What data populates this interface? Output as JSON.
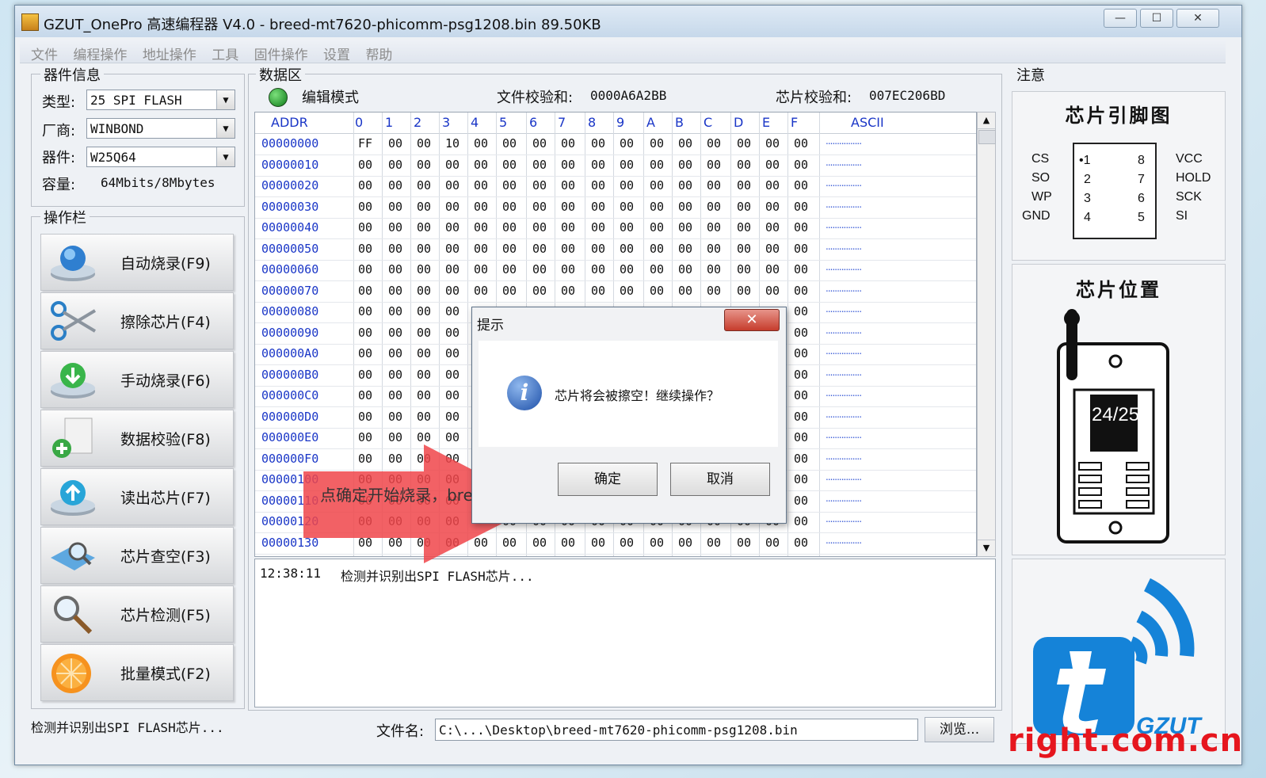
{
  "window": {
    "title": "GZUT_OnePro 高速编程器 V4.0 - breed-mt7620-phicomm-psg1208.bin  89.50KB",
    "min": "—",
    "max": "☐",
    "close": "✕"
  },
  "menu": [
    "文件",
    "编程操作",
    "地址操作",
    "工具",
    "固件操作",
    "设置",
    "帮助"
  ],
  "device_info": {
    "legend": "器件信息",
    "type_label": "类型:",
    "type_value": "25 SPI FLASH",
    "vendor_label": "厂商:",
    "vendor_value": "WINBOND",
    "device_label": "器件:",
    "device_value": "W25Q64",
    "capacity_label": "容量:",
    "capacity_value": "64Mbits/8Mbytes"
  },
  "operations": {
    "legend": "操作栏",
    "buttons": [
      {
        "label": "自动烧录(F9)",
        "icon": "globe-disk-icon"
      },
      {
        "label": "擦除芯片(F4)",
        "icon": "scissors-icon"
      },
      {
        "label": "手动烧录(F6)",
        "icon": "download-disk-icon"
      },
      {
        "label": "数据校验(F8)",
        "icon": "document-add-icon"
      },
      {
        "label": "读出芯片(F7)",
        "icon": "upload-disk-icon"
      },
      {
        "label": "芯片查空(F3)",
        "icon": "magnifier-disk-icon"
      },
      {
        "label": "芯片检测(F5)",
        "icon": "magnifier-icon"
      },
      {
        "label": "批量模式(F2)",
        "icon": "orange-slice-icon"
      }
    ]
  },
  "data_area": {
    "legend": "数据区",
    "mode_label": "编辑模式",
    "file_checksum_label": "文件校验和:",
    "file_checksum": "0000A6A2BB",
    "chip_checksum_label": "芯片校验和:",
    "chip_checksum": "007EC206BD",
    "headers": [
      "ADDR",
      "0",
      "1",
      "2",
      "3",
      "4",
      "5",
      "6",
      "7",
      "8",
      "9",
      "A",
      "B",
      "C",
      "D",
      "E",
      "F",
      "ASCII"
    ],
    "ascii_placeholder": "................",
    "rows": [
      {
        "addr": "00000000",
        "bytes": [
          "FF",
          "00",
          "00",
          "10",
          "00",
          "00",
          "00",
          "00",
          "00",
          "00",
          "00",
          "00",
          "00",
          "00",
          "00",
          "00"
        ]
      },
      {
        "addr": "00000010",
        "bytes": [
          "00",
          "00",
          "00",
          "00",
          "00",
          "00",
          "00",
          "00",
          "00",
          "00",
          "00",
          "00",
          "00",
          "00",
          "00",
          "00"
        ]
      },
      {
        "addr": "00000020",
        "bytes": [
          "00",
          "00",
          "00",
          "00",
          "00",
          "00",
          "00",
          "00",
          "00",
          "00",
          "00",
          "00",
          "00",
          "00",
          "00",
          "00"
        ]
      },
      {
        "addr": "00000030",
        "bytes": [
          "00",
          "00",
          "00",
          "00",
          "00",
          "00",
          "00",
          "00",
          "00",
          "00",
          "00",
          "00",
          "00",
          "00",
          "00",
          "00"
        ]
      },
      {
        "addr": "00000040",
        "bytes": [
          "00",
          "00",
          "00",
          "00",
          "00",
          "00",
          "00",
          "00",
          "00",
          "00",
          "00",
          "00",
          "00",
          "00",
          "00",
          "00"
        ]
      },
      {
        "addr": "00000050",
        "bytes": [
          "00",
          "00",
          "00",
          "00",
          "00",
          "00",
          "00",
          "00",
          "00",
          "00",
          "00",
          "00",
          "00",
          "00",
          "00",
          "00"
        ]
      },
      {
        "addr": "00000060",
        "bytes": [
          "00",
          "00",
          "00",
          "00",
          "00",
          "00",
          "00",
          "00",
          "00",
          "00",
          "00",
          "00",
          "00",
          "00",
          "00",
          "00"
        ]
      },
      {
        "addr": "00000070",
        "bytes": [
          "00",
          "00",
          "00",
          "00",
          "00",
          "00",
          "00",
          "00",
          "00",
          "00",
          "00",
          "00",
          "00",
          "00",
          "00",
          "00"
        ]
      },
      {
        "addr": "00000080",
        "bytes": [
          "00",
          "00",
          "00",
          "00",
          "",
          "",
          "",
          "",
          "",
          "",
          "",
          "",
          "",
          "",
          "",
          "00"
        ]
      },
      {
        "addr": "00000090",
        "bytes": [
          "00",
          "00",
          "00",
          "00",
          "",
          "",
          "",
          "",
          "",
          "",
          "",
          "",
          "",
          "",
          "",
          "00"
        ]
      },
      {
        "addr": "000000A0",
        "bytes": [
          "00",
          "00",
          "00",
          "00",
          "",
          "",
          "",
          "",
          "",
          "",
          "",
          "",
          "",
          "",
          "",
          "00"
        ]
      },
      {
        "addr": "000000B0",
        "bytes": [
          "00",
          "00",
          "00",
          "00",
          "",
          "",
          "",
          "",
          "",
          "",
          "",
          "",
          "",
          "",
          "",
          "00"
        ]
      },
      {
        "addr": "000000C0",
        "bytes": [
          "00",
          "00",
          "00",
          "00",
          "",
          "",
          "",
          "",
          "",
          "",
          "",
          "",
          "",
          "",
          "",
          "00"
        ]
      },
      {
        "addr": "000000D0",
        "bytes": [
          "00",
          "00",
          "00",
          "00",
          "",
          "",
          "",
          "",
          "",
          "",
          "",
          "",
          "",
          "",
          "",
          "00"
        ]
      },
      {
        "addr": "000000E0",
        "bytes": [
          "00",
          "00",
          "00",
          "00",
          "",
          "",
          "",
          "",
          "",
          "",
          "",
          "",
          "",
          "",
          "",
          "00"
        ]
      },
      {
        "addr": "000000F0",
        "bytes": [
          "00",
          "00",
          "00",
          "00",
          "",
          "",
          "",
          "",
          "",
          "",
          "",
          "",
          "",
          "",
          "",
          "00"
        ]
      },
      {
        "addr": "00000100",
        "bytes": [
          "00",
          "00",
          "00",
          "00",
          "",
          "",
          "",
          "",
          "",
          "",
          "",
          "",
          "",
          "",
          "",
          "00"
        ]
      },
      {
        "addr": "00000110",
        "bytes": [
          "00",
          "00",
          "00",
          "00",
          "",
          "",
          "",
          "",
          "",
          "",
          "",
          "",
          "",
          "",
          "",
          "00"
        ]
      },
      {
        "addr": "00000120",
        "bytes": [
          "00",
          "00",
          "00",
          "00",
          "",
          "00",
          "00",
          "00",
          "00",
          "00",
          "00",
          "00",
          "00",
          "00",
          "00",
          "00"
        ]
      },
      {
        "addr": "00000130",
        "bytes": [
          "00",
          "00",
          "00",
          "00",
          "00",
          "00",
          "00",
          "00",
          "00",
          "00",
          "00",
          "00",
          "00",
          "00",
          "00",
          "00"
        ]
      }
    ]
  },
  "log": {
    "time": "12:38:11",
    "message": "检测并识别出SPI FLASH芯片..."
  },
  "status": {
    "text": "检测并识别出SPI FLASH芯片...",
    "filename_label": "文件名:",
    "filename_value": "C:\\...\\Desktop\\breed-mt7620-phicomm-psg1208.bin",
    "browse_label": "浏览..."
  },
  "notice": {
    "legend": "注意",
    "pin_title": "芯片引脚图",
    "pins_left": [
      {
        "name": "CS",
        "num": "•1"
      },
      {
        "name": "SO",
        "num": "2"
      },
      {
        "name": "WP",
        "num": "3"
      },
      {
        "name": "GND",
        "num": "4"
      }
    ],
    "pins_right": [
      {
        "name": "VCC",
        "num": "8"
      },
      {
        "name": "HOLD",
        "num": "7"
      },
      {
        "name": "SCK",
        "num": "6"
      },
      {
        "name": "SI",
        "num": "5"
      }
    ],
    "position_title": "芯片位置",
    "socket_label": "24/25",
    "logo_text": "GZUT"
  },
  "dialog": {
    "title": "提示",
    "message": "芯片将会被擦空！继续操作？",
    "ok": "确定",
    "cancel": "取消",
    "close": "✕"
  },
  "annotation": {
    "text": "点确定开始烧录，breed"
  },
  "watermark": "right.com.cn",
  "colors": {
    "hex_blue": "#1a36c7",
    "arrow": "#f0454a",
    "watermark": "#e6161e",
    "logo_blue": "#1583d8"
  }
}
